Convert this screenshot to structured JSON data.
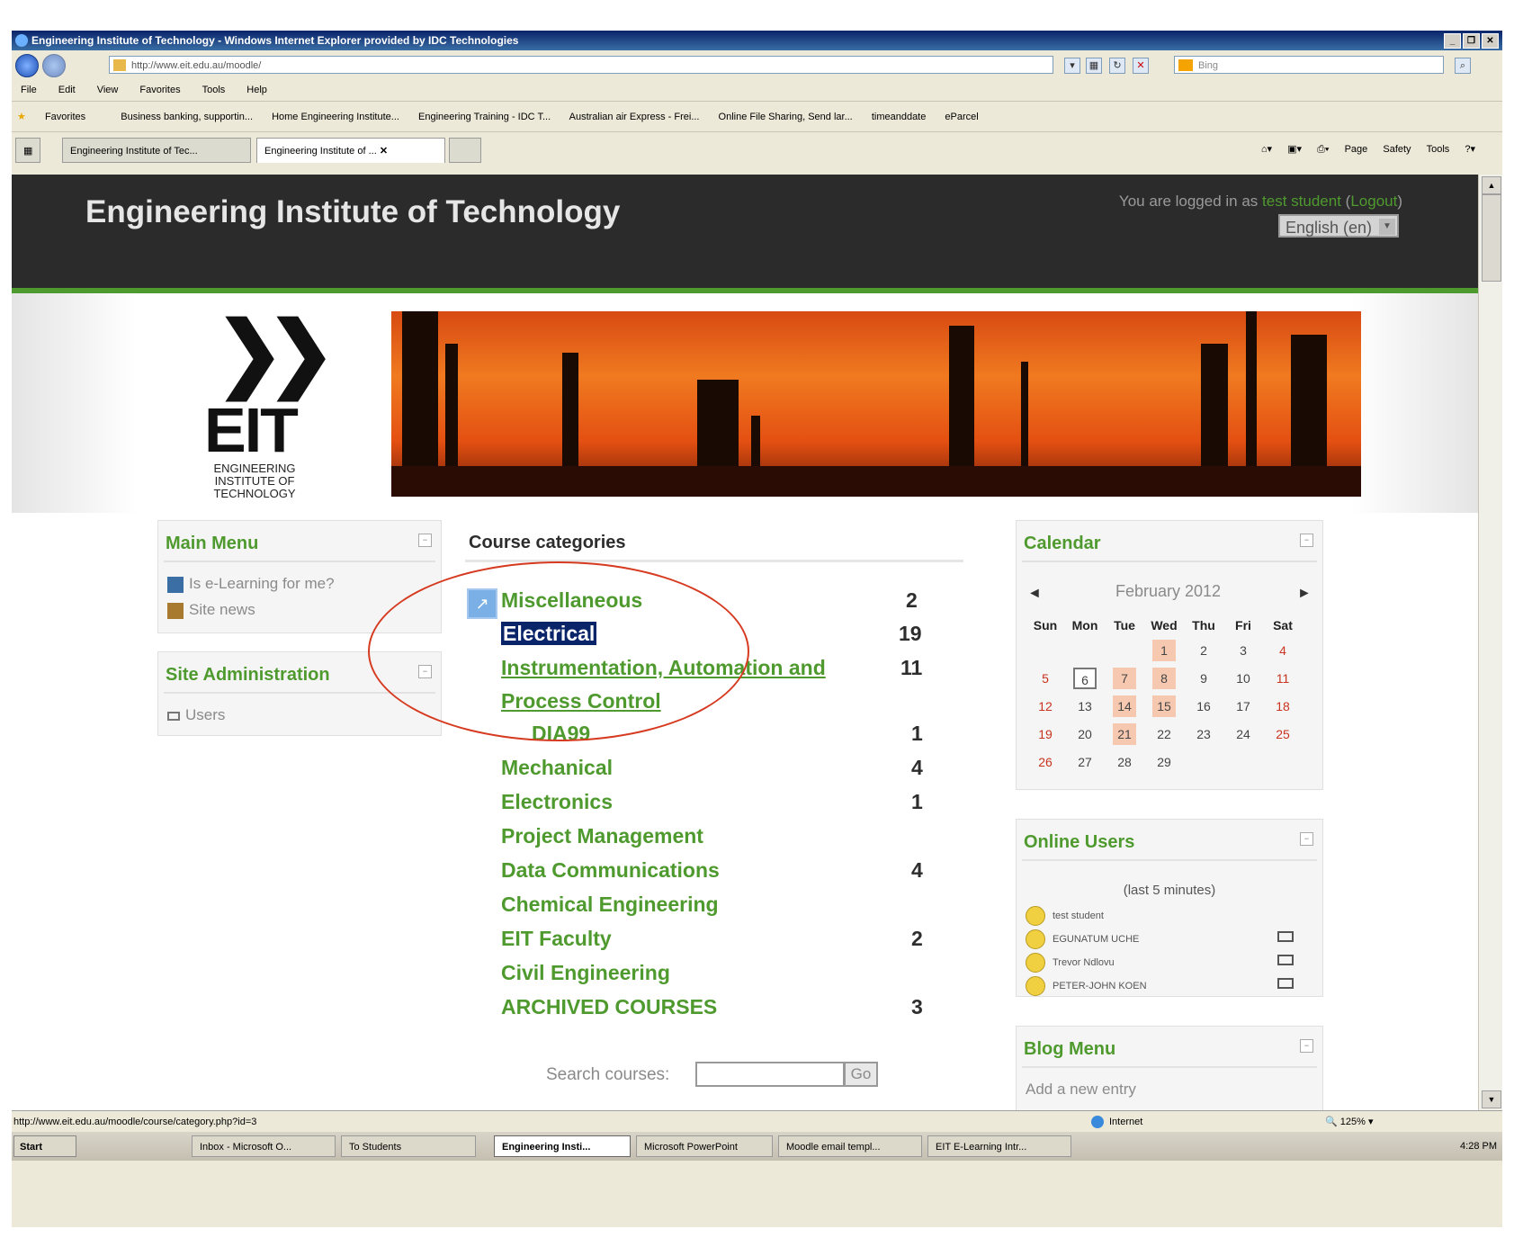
{
  "window": {
    "title": "Engineering Institute of Technology - Windows Internet Explorer provided by IDC Technologies"
  },
  "addressbar": {
    "url": "http://www.eit.edu.au/moodle/",
    "search_placeholder": "Bing"
  },
  "menu": [
    "File",
    "Edit",
    "View",
    "Favorites",
    "Tools",
    "Help"
  ],
  "favorites": {
    "label": "Favorites",
    "items": [
      "Business banking, supportin...",
      "Home  Engineering Institute...",
      "Engineering Training - IDC T...",
      "Australian air Express - Frei...",
      "Online File Sharing, Send lar...",
      "timeanddate",
      "eParcel"
    ]
  },
  "tabs": [
    {
      "label": "Engineering Institute of Tec..."
    },
    {
      "label": "Engineering Institute of ..."
    }
  ],
  "command_bar": [
    "Page",
    "Safety",
    "Tools"
  ],
  "site": {
    "title": "Engineering Institute of Technology",
    "login_prefix": "You are logged in as",
    "login_user": "test student",
    "logout_label": "Logout",
    "language": "English (en)"
  },
  "logo": {
    "mark": "EIT",
    "chevrons": "❯❯",
    "subtitle": "ENGINEERING INSTITUTE OF TECHNOLOGY"
  },
  "main_menu": {
    "title": "Main Menu",
    "items": [
      "Is e-Learning for me?",
      "Site news"
    ]
  },
  "site_admin": {
    "title": "Site Administration",
    "items": [
      "Users"
    ]
  },
  "course_categories": {
    "title": "Course categories",
    "items": [
      {
        "name": "Miscellaneous",
        "count": "2"
      },
      {
        "name": "Electrical",
        "count": "19"
      },
      {
        "name": "Instrumentation, Automation and",
        "name_line2": "Process Control",
        "count": "11"
      },
      {
        "name": "DIA99",
        "count": "1"
      },
      {
        "name": "Mechanical",
        "count": "4"
      },
      {
        "name": "Electronics",
        "count": "1"
      },
      {
        "name": "Project Management",
        "count": ""
      },
      {
        "name": "Data Communications",
        "count": "4"
      },
      {
        "name": "Chemical Engineering",
        "count": ""
      },
      {
        "name": "EIT Faculty",
        "count": "2"
      },
      {
        "name": "Civil Engineering",
        "count": ""
      },
      {
        "name": "ARCHIVED COURSES",
        "count": "3"
      }
    ],
    "search_label": "Search courses:",
    "go_label": "Go"
  },
  "calendar": {
    "title": "Calendar",
    "month": "February 2012",
    "prev": "◄",
    "next": "►",
    "days": [
      "Sun",
      "Mon",
      "Tue",
      "Wed",
      "Thu",
      "Fri",
      "Sat"
    ],
    "weeks": [
      [
        "",
        "",
        "",
        "1",
        "2",
        "3",
        "4"
      ],
      [
        "5",
        "6",
        "7",
        "8",
        "9",
        "10",
        "11"
      ],
      [
        "12",
        "13",
        "14",
        "15",
        "16",
        "17",
        "18"
      ],
      [
        "19",
        "20",
        "21",
        "22",
        "23",
        "24",
        "25"
      ],
      [
        "26",
        "27",
        "28",
        "29",
        "",
        "",
        ""
      ]
    ],
    "event_days": [
      "1",
      "7",
      "8",
      "14",
      "15",
      "21"
    ],
    "today": "6"
  },
  "online_users": {
    "title": "Online Users",
    "period": "(last 5 minutes)",
    "users": [
      "test student",
      "EGUNATUM UCHE",
      "Trevor Ndlovu",
      "PETER-JOHN KOEN"
    ]
  },
  "blog_menu": {
    "title": "Blog Menu",
    "items": [
      "Add a new entry"
    ]
  },
  "statusbar": {
    "url": "http://www.eit.edu.au/moodle/course/category.php?id=3",
    "zone": "Internet",
    "zoom": "125%"
  },
  "taskbar": {
    "start": "Start",
    "items": [
      "Inbox - Microsoft O...",
      "To Students",
      "Engineering Insti...",
      "Microsoft PowerPoint",
      "Moodle email templ...",
      "EIT E-Learning Intr..."
    ],
    "clock": "4:28 PM"
  },
  "colors": {
    "accent_green": "#4f9a2e",
    "header_dark": "#2b2b2b",
    "annotation_red": "#d63a20"
  }
}
